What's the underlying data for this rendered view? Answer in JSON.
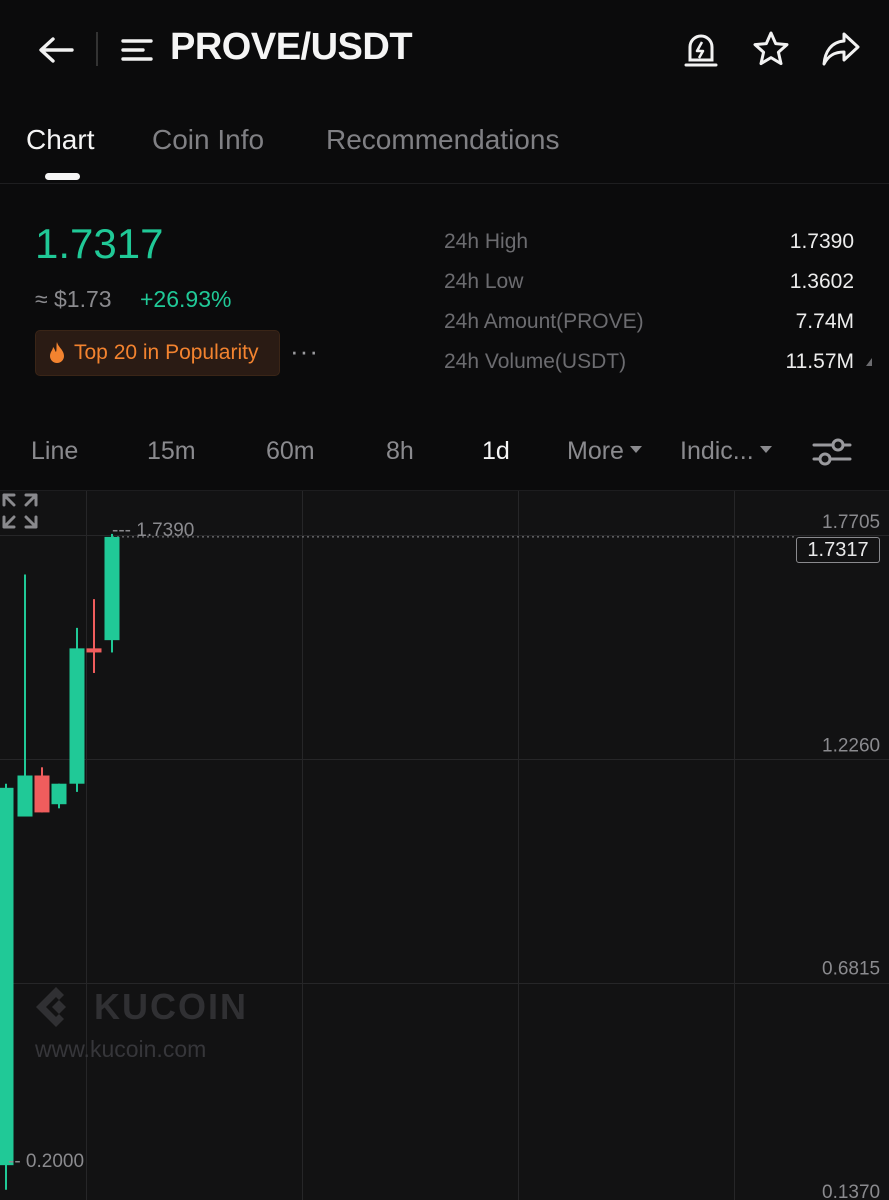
{
  "header": {
    "title": "PROVE/USDT",
    "icons": [
      "back-arrow-icon",
      "menu-icon",
      "price-alert-icon",
      "star-icon",
      "share-icon"
    ]
  },
  "tabs": [
    {
      "label": "Chart",
      "active": true
    },
    {
      "label": "Coin Info",
      "active": false
    },
    {
      "label": "Recommendations",
      "active": false
    }
  ],
  "ticker": {
    "price": "1.7317",
    "approx_fiat": "≈ $1.73",
    "change": "+26.93%",
    "badge": "Top 20 in Popularity",
    "badge_icon": "fire-icon",
    "more": "···"
  },
  "stats": [
    {
      "label": "24h High",
      "value": "1.7390"
    },
    {
      "label": "24h Low",
      "value": "1.3602"
    },
    {
      "label": "24h Amount(PROVE)",
      "value": "7.74M"
    },
    {
      "label": "24h Volume(USDT)",
      "value": "11.57M"
    }
  ],
  "intervals": [
    {
      "label": "Line",
      "active": false
    },
    {
      "label": "15m",
      "active": false
    },
    {
      "label": "60m",
      "active": false
    },
    {
      "label": "8h",
      "active": false
    },
    {
      "label": "1d",
      "active": true
    },
    {
      "label": "More",
      "active": false
    },
    {
      "label": "Indic...",
      "active": false
    }
  ],
  "colors": {
    "up": "#20c997",
    "down": "#ef5d5d",
    "badge": "#f3832f",
    "background": "#0b0b0c"
  },
  "chart_data": {
    "type": "candlestick",
    "y_axis_ticks": [
      "1.7705",
      "1.2260",
      "0.6815",
      "0.1370"
    ],
    "ylim": [
      0.137,
      1.7705
    ],
    "current_price_tag": "1.7317",
    "high_marker": "1.7390",
    "low_marker": "0.2000",
    "candles": [
      {
        "open": 1.12,
        "high": 1.13,
        "low": 0.14,
        "close": 0.2,
        "direction": "up"
      },
      {
        "open": 1.05,
        "high": 1.64,
        "low": 1.05,
        "close": 1.15,
        "direction": "up"
      },
      {
        "open": 1.15,
        "high": 1.17,
        "low": 1.06,
        "close": 1.06,
        "direction": "down"
      },
      {
        "open": 1.08,
        "high": 1.13,
        "low": 1.07,
        "close": 1.13,
        "direction": "up"
      },
      {
        "open": 1.13,
        "high": 1.51,
        "low": 1.11,
        "close": 1.46,
        "direction": "up"
      },
      {
        "open": 1.46,
        "high": 1.58,
        "low": 1.4,
        "close": 1.45,
        "direction": "down"
      },
      {
        "open": 1.48,
        "high": 1.739,
        "low": 1.45,
        "close": 1.7317,
        "direction": "up"
      }
    ],
    "watermark": {
      "brand": "KUCOIN",
      "url": "www.kucoin.com"
    }
  }
}
